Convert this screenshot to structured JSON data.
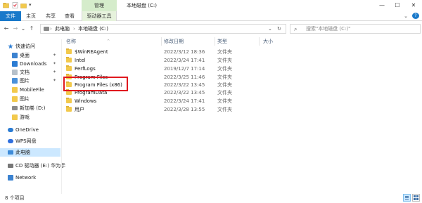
{
  "window": {
    "title": "本地磁盘 (C:)",
    "context_tab_group": "管理",
    "minimize": "—",
    "maximize": "☐",
    "close": "✕"
  },
  "ribbon": {
    "tabs": [
      "文件",
      "主页",
      "共享",
      "查看",
      "驱动器工具"
    ],
    "expand": "⌄",
    "help": "?"
  },
  "address": {
    "back": "←",
    "forward": "→",
    "recent": "⌄",
    "up": "↑",
    "breadcrumb": [
      "此电脑",
      "本地磁盘 (C:)"
    ],
    "separator": "›",
    "dropdown": "⌄",
    "refresh": "↻"
  },
  "search": {
    "placeholder": "搜索\"本地磁盘 (C:)\""
  },
  "sidebar": {
    "items": [
      {
        "label": "快速访问",
        "icon": "star-icon",
        "color": "#2b7cd3"
      },
      {
        "label": "桌面",
        "icon": "desktop-icon",
        "color": "#3b82d0",
        "pinned": true
      },
      {
        "label": "Downloads",
        "icon": "download-icon",
        "color": "#2b7cd3",
        "pinned": true
      },
      {
        "label": "文档",
        "icon": "document-icon",
        "color": "#7f8c99",
        "pinned": true
      },
      {
        "label": "图片",
        "icon": "picture-icon",
        "color": "#4a90d9",
        "pinned": true
      },
      {
        "label": "MobileFile",
        "icon": "folder-icon",
        "color": "#f2c94c"
      },
      {
        "label": "图片",
        "icon": "folder-icon",
        "color": "#f2c94c"
      },
      {
        "label": "新加卷 (D:)",
        "icon": "drive-icon",
        "color": "#8a8a8a"
      },
      {
        "label": "游戏",
        "icon": "folder-icon",
        "color": "#f2c94c"
      },
      {
        "label": "OneDrive",
        "icon": "cloud-icon",
        "color": "#2b7cd3"
      },
      {
        "label": "WPS网盘",
        "icon": "cloud-icon",
        "color": "#2f6fde"
      },
      {
        "label": "此电脑",
        "icon": "computer-icon",
        "color": "#3d8bd8",
        "selected": true
      },
      {
        "label": "CD 驱动器 (E:) 华为手",
        "icon": "cd-drive-icon",
        "color": "#777777"
      },
      {
        "label": "Network",
        "icon": "network-icon",
        "color": "#3b82d0"
      }
    ],
    "pin_glyph": "📌"
  },
  "columns": {
    "name": "名称",
    "date": "修改日期",
    "type": "类型",
    "size": "大小",
    "sort_indicator": "^"
  },
  "files": [
    {
      "name": "$WinREAgent",
      "date": "2022/3/12 18:36",
      "type": "文件夹"
    },
    {
      "name": "Intel",
      "date": "2022/3/24 17:41",
      "type": "文件夹"
    },
    {
      "name": "PerfLogs",
      "date": "2019/12/7 17:14",
      "type": "文件夹"
    },
    {
      "name": "Program Files",
      "date": "2022/3/25 11:46",
      "type": "文件夹"
    },
    {
      "name": "Program Files (x86)",
      "date": "2022/3/22 13:45",
      "type": "文件夹"
    },
    {
      "name": "ProgramData",
      "date": "2022/3/22 13:45",
      "type": "文件夹"
    },
    {
      "name": "Windows",
      "date": "2022/3/24 17:41",
      "type": "文件夹"
    },
    {
      "name": "用户",
      "date": "2022/3/28 13:55",
      "type": "文件夹"
    }
  ],
  "status": {
    "item_count": "8 个项目"
  },
  "colors": {
    "file_tab": "#1979ca",
    "context_tab": "#d5eccb",
    "selection": "#cce8ff",
    "highlight_box": "#e0191f",
    "folder": "#f2c94c"
  }
}
